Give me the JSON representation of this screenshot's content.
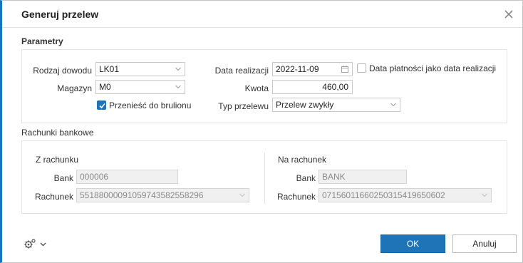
{
  "dialog": {
    "title": "Generuj przelew",
    "close_icon": "close-icon"
  },
  "parametry": {
    "section_title": "Parametry",
    "rodzaj_dowodu": {
      "label": "Rodzaj dowodu",
      "value": "LK01"
    },
    "magazyn": {
      "label": "Magazyn",
      "value": "M0"
    },
    "przenies": {
      "label": "Przenieść do brulionu",
      "checked": true
    },
    "data_realizacji": {
      "label": "Data realizacji",
      "value": "2022-11-09"
    },
    "data_platnosci": {
      "label": "Data płatności jako data realizacji",
      "checked": false
    },
    "kwota": {
      "label": "Kwota",
      "value": "460,00"
    },
    "typ_przelewu": {
      "label": "Typ przelewu",
      "value": "Przelew zwykły"
    }
  },
  "rachunki": {
    "section_title": "Rachunki bankowe",
    "z_rachunku": {
      "title": "Z rachunku",
      "bank_label": "Bank",
      "bank_value": "000006",
      "rachunek_label": "Rachunek",
      "rachunek_value": "55188000091059743582558296"
    },
    "na_rachunek": {
      "title": "Na rachunek",
      "bank_label": "Bank",
      "bank_value": "BANK",
      "rachunek_label": "Rachunek",
      "rachunek_value": "07156011660250315419650602"
    }
  },
  "footer": {
    "ok_label": "OK",
    "cancel_label": "Anuluj",
    "settings_icon": "gear-icon"
  },
  "colors": {
    "accent": "#1f73b7"
  }
}
